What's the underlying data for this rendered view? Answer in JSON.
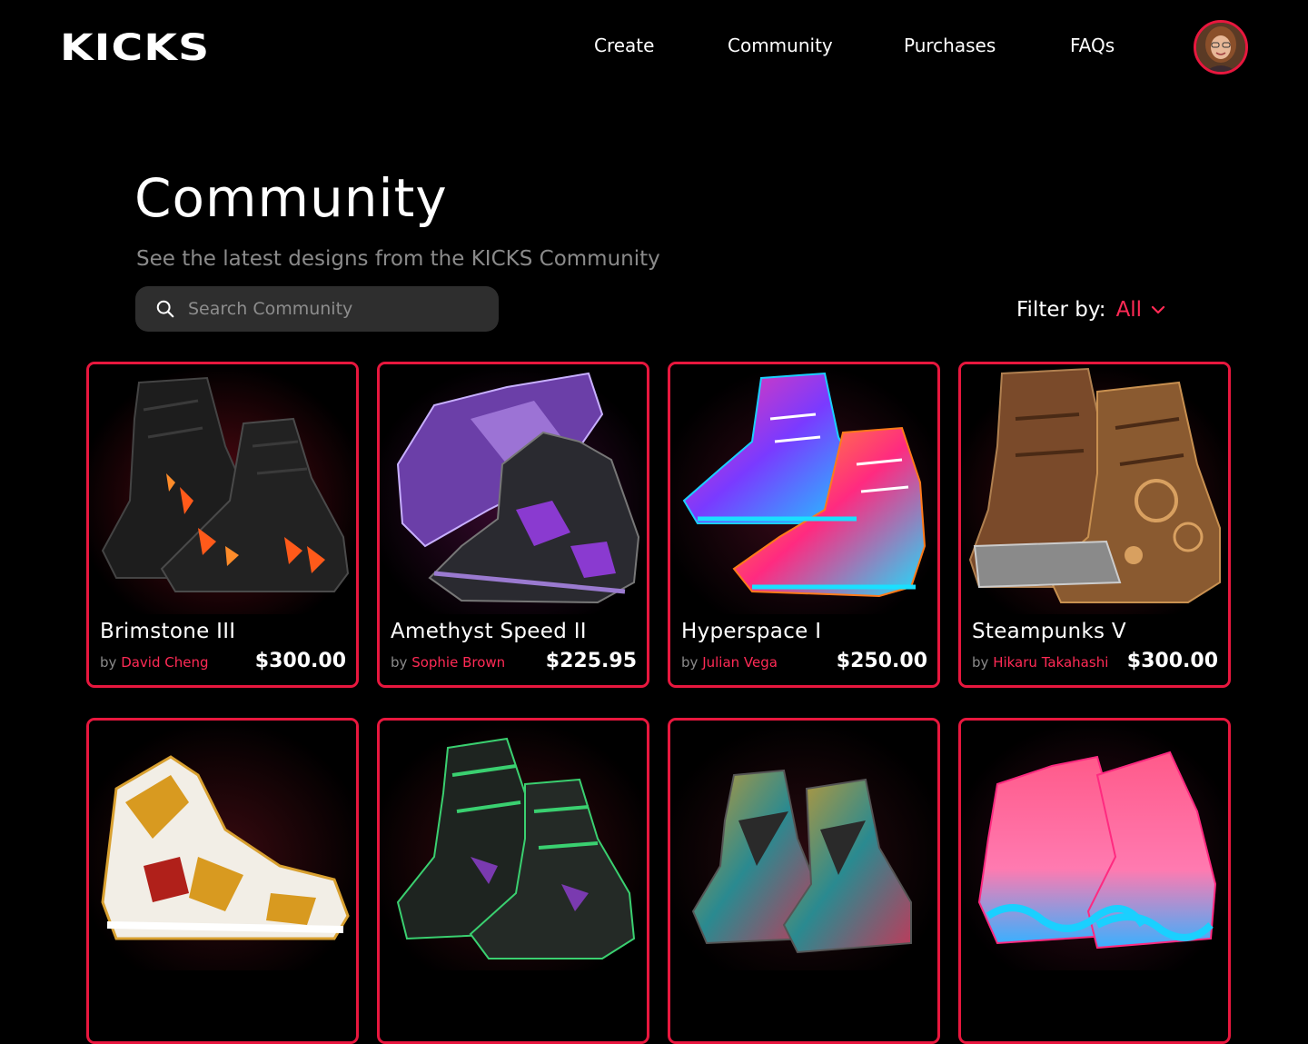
{
  "brand": {
    "logo": "KICKS"
  },
  "nav": {
    "items": [
      {
        "label": "Create"
      },
      {
        "label": "Community"
      },
      {
        "label": "Purchases"
      },
      {
        "label": "FAQs"
      }
    ]
  },
  "page": {
    "title": "Community",
    "subtitle": "See the latest designs from the KICKS Community"
  },
  "search": {
    "placeholder": "Search Community",
    "value": ""
  },
  "filter": {
    "label": "Filter by:",
    "value": "All"
  },
  "colors": {
    "accent": "#ff2a55",
    "card_border": "#e8173e",
    "background": "#000000",
    "search_bg": "#2e2e2e",
    "muted_text": "#8a8a8a"
  },
  "icons": {
    "search": "search-icon",
    "filter_dropdown": "chevron-down-icon",
    "avatar": "user-avatar"
  },
  "by_prefix": "by",
  "products": [
    {
      "name": "Brimstone III",
      "author": "David Cheng",
      "price": "$300.00",
      "image": "black sneakers with lava cracks"
    },
    {
      "name": "Amethyst Speed II",
      "author": "Sophie Brown",
      "price": "$225.95",
      "image": "purple crystal sneakers"
    },
    {
      "name": "Hyperspace I",
      "author": "Julian Vega",
      "price": "$250.00",
      "image": "neon galaxy sneakers"
    },
    {
      "name": "Steampunks V",
      "author": "Hikaru Takahashi",
      "price": "$300.00",
      "image": "bronze steampunk boots"
    },
    {
      "name": "",
      "author": "",
      "price": "",
      "image": "white and gold ornate sneaker"
    },
    {
      "name": "",
      "author": "",
      "price": "",
      "image": "black and green sneakers"
    },
    {
      "name": "",
      "author": "",
      "price": "",
      "image": "multicolor geometric sneakers"
    },
    {
      "name": "",
      "author": "",
      "price": "",
      "image": "pink and blue sneakers"
    }
  ]
}
